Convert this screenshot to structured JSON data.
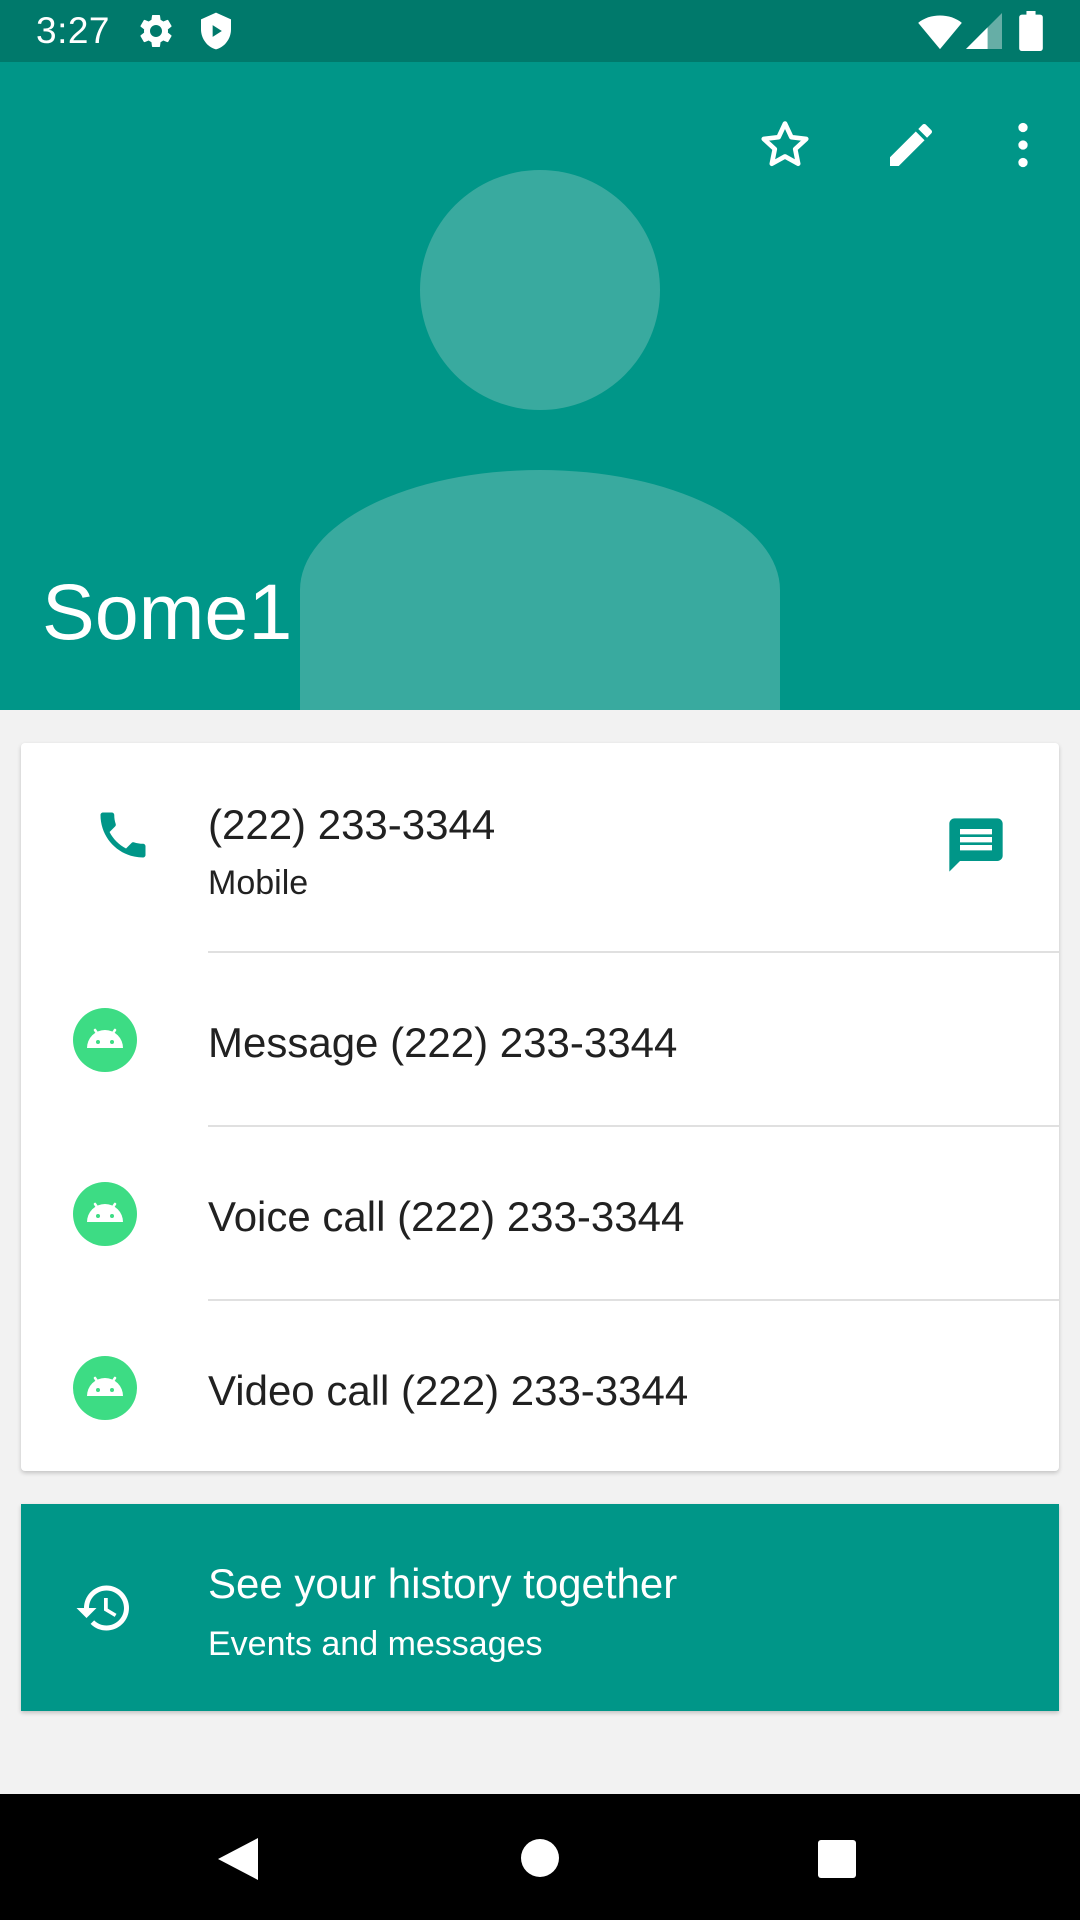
{
  "status_bar": {
    "time": "3:27",
    "icons": [
      "settings-icon",
      "shield-icon",
      "wifi-icon",
      "signal-icon",
      "battery-icon"
    ]
  },
  "header": {
    "contact_name": "Some1",
    "actions": [
      "star-icon",
      "edit-icon",
      "more-vert-icon"
    ],
    "color": "#009688"
  },
  "phone": {
    "number": "(222) 233-3344",
    "type": "Mobile"
  },
  "actions": [
    {
      "label": "Message (222) 233-3344",
      "icon": "android-app-icon"
    },
    {
      "label": "Voice call (222) 233-3344",
      "icon": "android-app-icon"
    },
    {
      "label": "Video call (222) 233-3344",
      "icon": "android-app-icon"
    }
  ],
  "history": {
    "title": "See your history together",
    "subtitle": "Events and messages"
  },
  "nav_bar": [
    "back-icon",
    "home-icon",
    "recents-icon"
  ],
  "colors": {
    "primary": "#009688",
    "primary_dark": "#00796b",
    "android_green": "#3ddc84"
  }
}
